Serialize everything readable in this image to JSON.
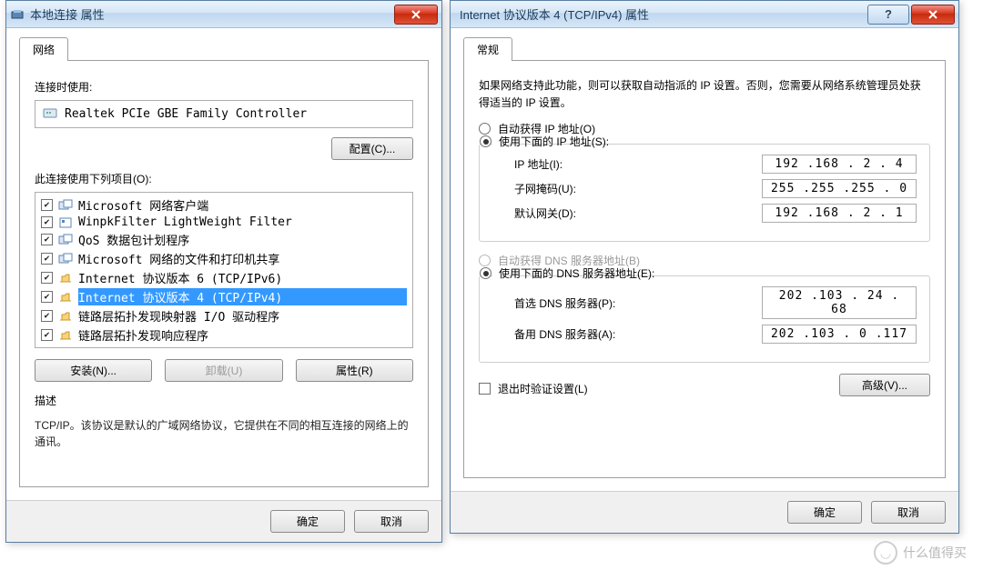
{
  "left_window": {
    "title": "本地连接 属性",
    "tab_label": "网络",
    "connect_using_label": "连接时使用:",
    "adapter_name": "Realtek PCIe GBE Family Controller",
    "configure_btn": "配置(C)...",
    "items_label": "此连接使用下列项目(O):",
    "items": [
      {
        "text": "Microsoft 网络客户端",
        "checked": true,
        "selected": false
      },
      {
        "text": "WinpkFilter LightWeight Filter",
        "checked": true,
        "selected": false
      },
      {
        "text": "QoS 数据包计划程序",
        "checked": true,
        "selected": false
      },
      {
        "text": "Microsoft 网络的文件和打印机共享",
        "checked": true,
        "selected": false
      },
      {
        "text": "Internet 协议版本 6 (TCP/IPv6)",
        "checked": true,
        "selected": false
      },
      {
        "text": "Internet 协议版本 4 (TCP/IPv4)",
        "checked": true,
        "selected": true
      },
      {
        "text": "链路层拓扑发现映射器 I/O 驱动程序",
        "checked": true,
        "selected": false
      },
      {
        "text": "链路层拓扑发现响应程序",
        "checked": true,
        "selected": false
      }
    ],
    "install_btn": "安装(N)...",
    "uninstall_btn": "卸载(U)",
    "properties_btn": "属性(R)",
    "desc_label": "描述",
    "desc_text": "TCP/IP。该协议是默认的广域网络协议，它提供在不同的相互连接的网络上的通讯。",
    "ok_btn": "确定",
    "cancel_btn": "取消"
  },
  "right_window": {
    "title": "Internet 协议版本 4 (TCP/IPv4) 属性",
    "tab_label": "常规",
    "info_text": "如果网络支持此功能，则可以获取自动指派的 IP 设置。否则，您需要从网络系统管理员处获得适当的 IP 设置。",
    "ip_section": {
      "radio_auto": "自动获得 IP 地址(O)",
      "radio_manual": "使用下面的 IP 地址(S):",
      "ip_label": "IP 地址(I):",
      "ip_value": "192 .168 .  2 .  4",
      "mask_label": "子网掩码(U):",
      "mask_value": "255 .255 .255 .  0",
      "gw_label": "默认网关(D):",
      "gw_value": "192 .168 .  2 .  1"
    },
    "dns_section": {
      "radio_auto": "自动获得 DNS 服务器地址(B)",
      "radio_manual": "使用下面的 DNS 服务器地址(E):",
      "pref_label": "首选 DNS 服务器(P):",
      "pref_value": "202 .103 . 24 . 68",
      "alt_label": "备用 DNS 服务器(A):",
      "alt_value": "202 .103 .  0 .117"
    },
    "validate_label": "退出时验证设置(L)",
    "advanced_btn": "高级(V)...",
    "ok_btn": "确定",
    "cancel_btn": "取消"
  },
  "watermark": "什么值得买"
}
